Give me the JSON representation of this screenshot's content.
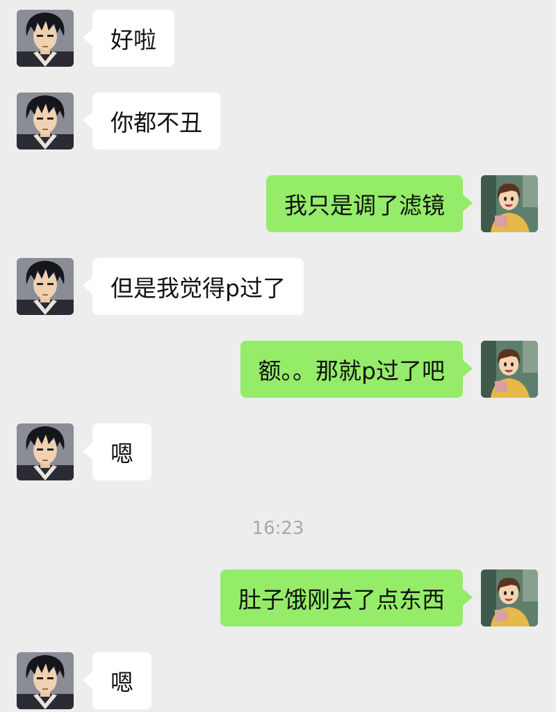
{
  "chat": {
    "messages": [
      {
        "sender": "contact",
        "text": "好啦"
      },
      {
        "sender": "contact",
        "text": "你都不丑"
      },
      {
        "sender": "me",
        "text": "我只是调了滤镜"
      },
      {
        "sender": "contact",
        "text": "但是我觉得p过了"
      },
      {
        "sender": "me",
        "text": "额。。那就p过了吧"
      },
      {
        "sender": "contact",
        "text": "嗯"
      },
      {
        "sender": "me",
        "text": "肚子饿刚去了点东西"
      },
      {
        "sender": "contact",
        "text": "嗯"
      }
    ],
    "timestamp": "16:23"
  },
  "colors": {
    "background": "#ededed",
    "incoming_bubble": "#ffffff",
    "outgoing_bubble": "#95ec69",
    "timestamp_text": "#a8a8a8"
  },
  "icons": {
    "contact_avatar": "anime-man-avatar",
    "my_avatar": "anime-girl-avatar"
  }
}
